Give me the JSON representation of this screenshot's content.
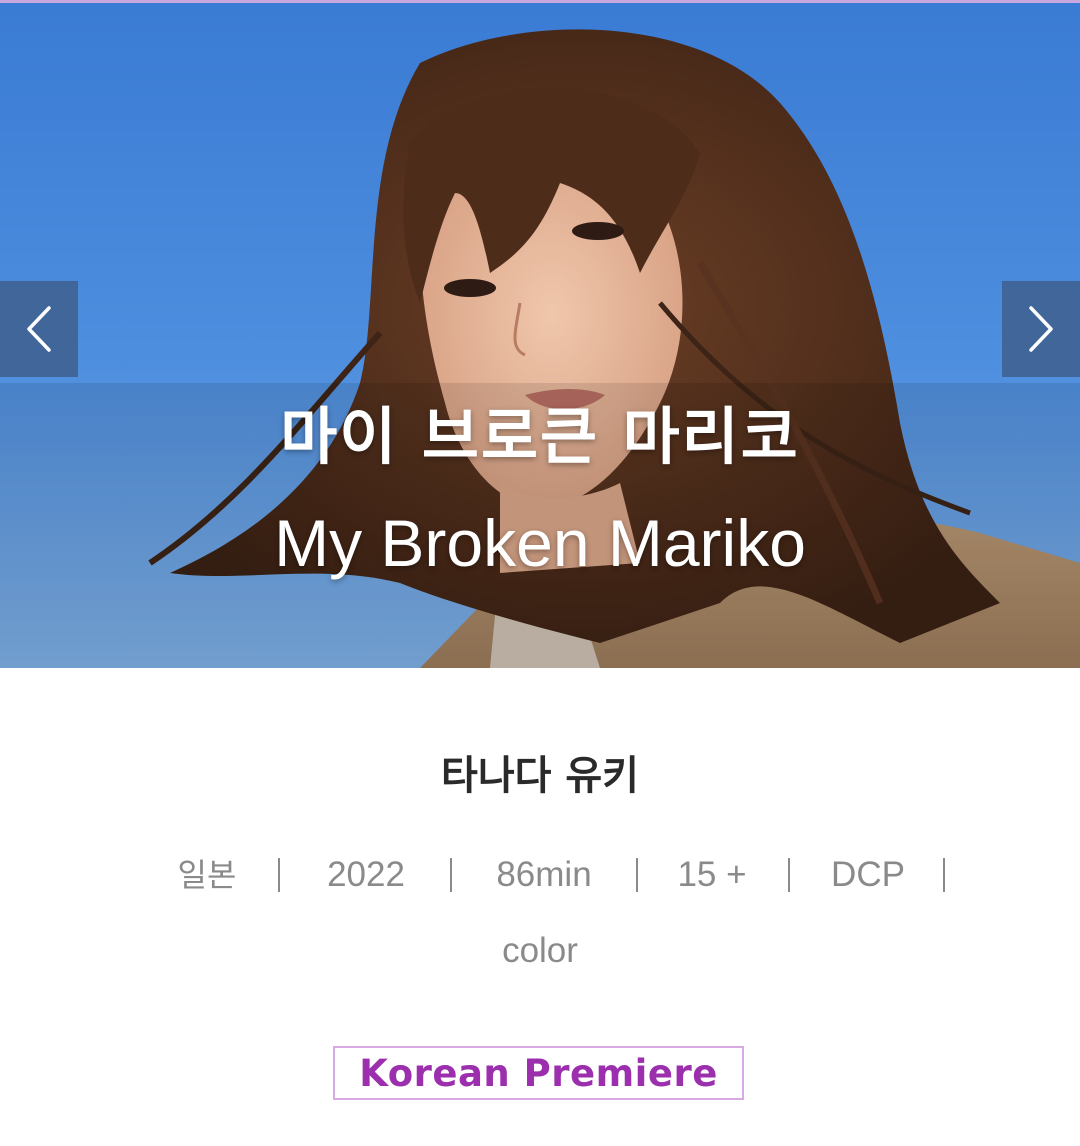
{
  "hero": {
    "title_ko": "마이 브로큰 마리코",
    "title_en": "My Broken Mariko",
    "prev_icon": "chevron-left-icon",
    "next_icon": "chevron-right-icon"
  },
  "film": {
    "director": "타나다 유키",
    "meta": [
      "일본",
      "2022",
      "86min",
      "15 +",
      "DCP"
    ],
    "meta_second_line": "color",
    "badge": "Korean Premiere"
  },
  "colors": {
    "badge_text": "#9b2fae",
    "badge_border": "#d9a9e3",
    "meta_text": "#8a8a8a",
    "sky": "#3f80d6",
    "nav_button": "#3c5880"
  }
}
